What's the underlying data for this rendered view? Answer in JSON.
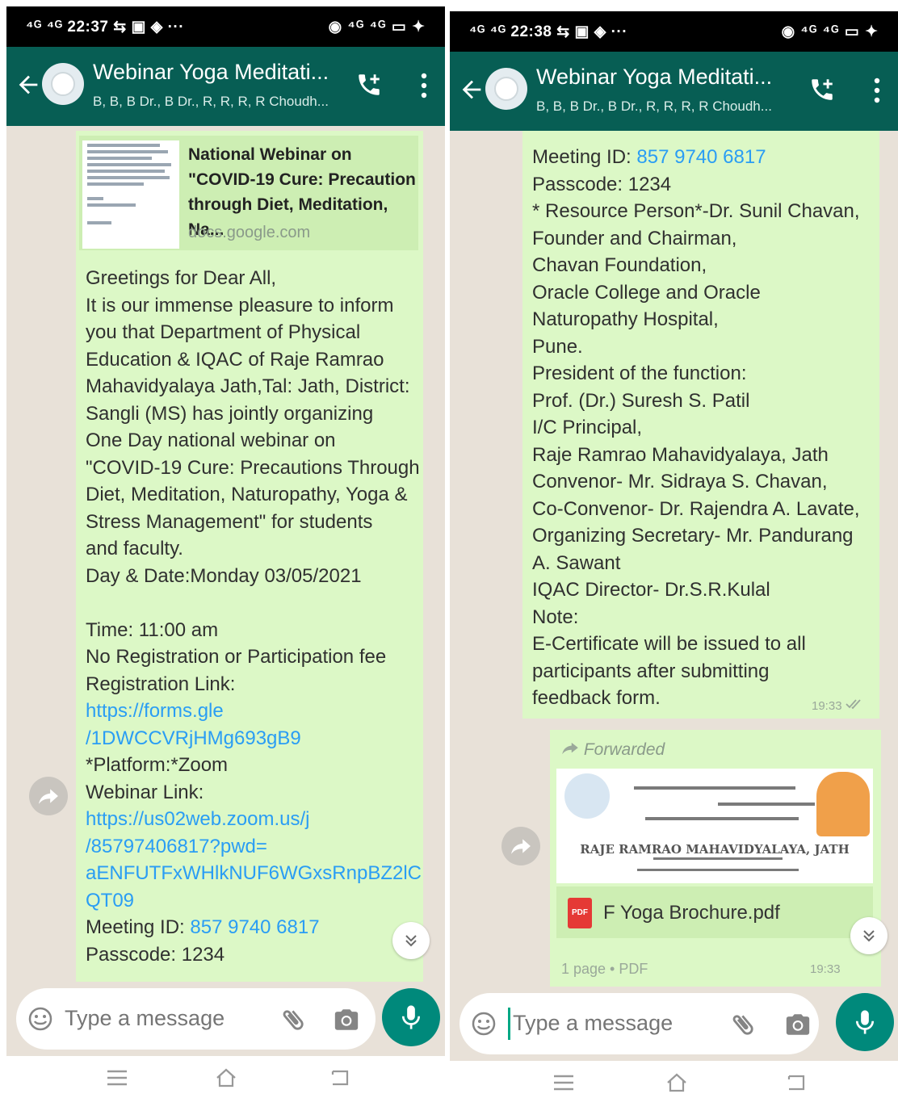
{
  "left": {
    "status": {
      "time": "22:37",
      "left_icons": "⁴ᴳ ⁴ᴳ 22:37 ⇆ ▣ ◈ ···",
      "right_icons": "◉ ⁴ᴳ ⁴ᴳ ▭ ✦"
    },
    "header": {
      "title": "Webinar Yoga Meditati...",
      "members": "B, B, B Dr., B Dr., R, R, R, R Choudh..."
    },
    "link_preview": {
      "title": "National Webinar on \"COVID-19 Cure: Precaution through Diet, Meditation, Na...",
      "domain": "docs.google.com"
    },
    "message_lines": [
      {
        "t": "Greetings for Dear All,"
      },
      {
        "t": "It is our immense pleasure to inform"
      },
      {
        "t": "you that Department of Physical"
      },
      {
        "t": "Education & IQAC  of Raje Ramrao"
      },
      {
        "t": "Mahavidyalaya Jath,Tal: Jath, District:"
      },
      {
        "t": "Sangli (MS) has jointly organizing"
      },
      {
        "t": "One Day national webinar on"
      },
      {
        "t": "\"COVID-19 Cure: Precautions Through"
      },
      {
        "t": "Diet, Meditation, Naturopathy,  Yoga &"
      },
      {
        "t": "Stress Management\" for students"
      },
      {
        "t": "and faculty."
      },
      {
        "t": "Day & Date:Monday 03/05/2021"
      },
      {
        "t": ""
      },
      {
        "t": "Time: 11:00 am"
      },
      {
        "t": " No Registration or Participation  fee"
      },
      {
        "t": " Registration Link:"
      },
      {
        "t": "https://forms.gle",
        "link": true
      },
      {
        "t": "/1DWCCVRjHMg693gB9",
        "link": true
      },
      {
        "t": "*Platform:*Zoom"
      },
      {
        "t": " Webinar Link:"
      },
      {
        "t": "https://us02web.zoom.us/j",
        "link": true
      },
      {
        "t": "/85797406817?pwd=",
        "link": true
      },
      {
        "t": "aENFUTFxWHlkNUF6WGxsRnpBZ2lC",
        "link": true
      },
      {
        "t": "QT09",
        "link": true
      },
      {
        "t": "Meeting ID: ",
        "link_suffix": "857 9740 6817"
      },
      {
        "t": "Passcode: 1234"
      }
    ],
    "composer": {
      "placeholder": "Type a message"
    }
  },
  "right": {
    "status": {
      "time": "22:38",
      "left_icons": "⁴ᴳ ⁴ᴳ 22:38 ⇆ ▣ ◈ ···",
      "right_icons": "◉ ⁴ᴳ ⁴ᴳ ▭ ✦"
    },
    "header": {
      "title": "Webinar Yoga Meditati...",
      "members": "B, B, B Dr., B Dr., R, R, R, R Choudh..."
    },
    "message_lines": [
      {
        "t": "Meeting ID: ",
        "link_suffix": "857 9740 6817"
      },
      {
        "t": "Passcode: 1234"
      },
      {
        "t": "* Resource Person*-Dr. Sunil Chavan,"
      },
      {
        "t": "   Founder and Chairman,"
      },
      {
        "t": "Chavan Foundation,"
      },
      {
        "t": "Oracle College and Oracle"
      },
      {
        "t": "Naturopathy Hospital,"
      },
      {
        "t": "Pune."
      },
      {
        "t": "President of the function:"
      },
      {
        "t": "Prof. (Dr.) Suresh S. Patil"
      },
      {
        "t": "I/C Principal,"
      },
      {
        "t": "Raje Ramrao Mahavidyalaya, Jath"
      },
      {
        "t": "Convenor- Mr. Sidraya S. Chavan,"
      },
      {
        "t": "Co-Convenor- Dr. Rajendra A. Lavate,"
      },
      {
        "t": "Organizing Secretary- Mr. Pandurang"
      },
      {
        "t": "A. Sawant"
      },
      {
        "t": "IQAC Director- Dr.S.R.Kulal"
      },
      {
        "t": "Note:"
      },
      {
        "t": "E-Certificate will be issued to all"
      },
      {
        "t": "participants after submitting"
      },
      {
        "t": "feedback form."
      }
    ],
    "message_time": "19:33",
    "forwarded": {
      "label": "Forwarded",
      "brochure_title": "RAJE RAMRAO MAHAVIDYALAYA, JATH",
      "file_name": "F Yoga Brochure.pdf",
      "pdf_badge": "PDF",
      "meta": "1 page • PDF",
      "time": "19:33"
    },
    "composer": {
      "placeholder": "Type a message"
    }
  },
  "icons": [
    "back-arrow-icon",
    "add-call-icon",
    "more-vert-icon",
    "forward-icon",
    "scroll-down-icon",
    "emoji-icon",
    "attach-icon",
    "camera-icon",
    "mic-icon",
    "recents-icon",
    "home-icon",
    "back-nav-icon",
    "double-check-icon"
  ],
  "colors": {
    "header": "#075e54",
    "bubble": "#dcf8c6",
    "link": "#2a9df4",
    "mic": "#00897b",
    "chat_bg": "#e8e1d8"
  }
}
